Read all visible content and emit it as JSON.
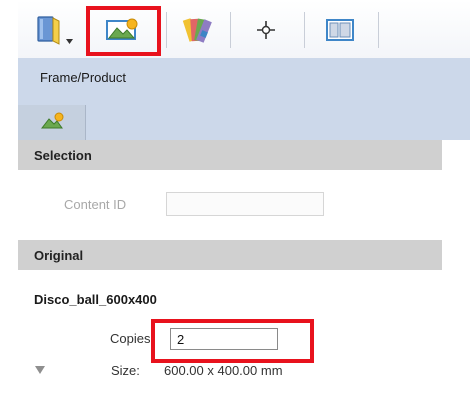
{
  "toolbar": {
    "buttons": [
      {
        "icon": "book-icon"
      },
      {
        "icon": "image-frame-icon"
      },
      {
        "icon": "color-swatch-icon"
      },
      {
        "icon": "crosshair-icon"
      },
      {
        "icon": "layout-icon"
      }
    ],
    "highlight_color": "#e8121d"
  },
  "panel": {
    "title": "Frame/Product",
    "tab_icon": "image-frame-icon"
  },
  "selection": {
    "header": "Selection",
    "content_id_label": "Content ID",
    "content_id_value": ""
  },
  "original": {
    "header": "Original",
    "filename": "Disco_ball_600x400",
    "copies_label": "Copies:",
    "copies_value": "2",
    "size_label": "Size:",
    "size_value": "600.00 x 400.00 mm"
  },
  "colors": {
    "panel_header": "#ccd8ea",
    "section_bar": "#d0d0d0",
    "highlight": "#e8121d"
  }
}
